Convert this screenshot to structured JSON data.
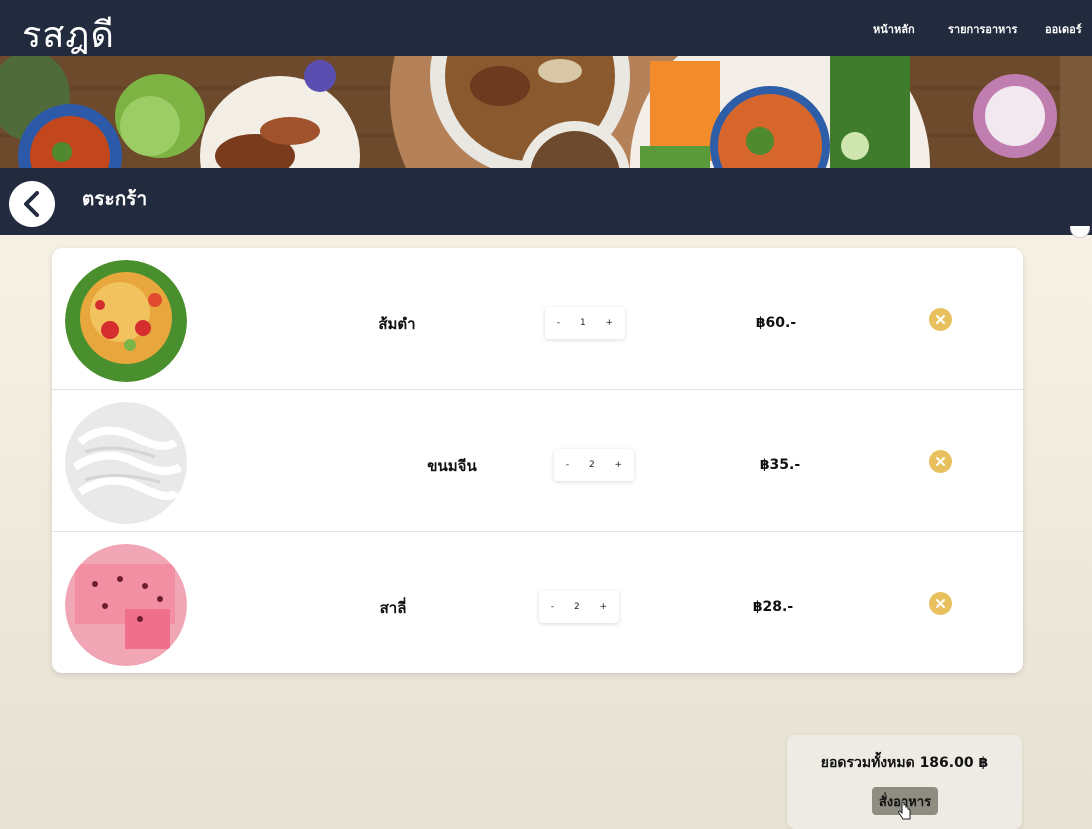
{
  "brand": {
    "name": "รสฎดี"
  },
  "nav": {
    "items": [
      {
        "label": "หน้าหลัก"
      },
      {
        "label": "รายการอาหาร"
      },
      {
        "label": "ออเดอร์"
      }
    ]
  },
  "header": {
    "title": "ตระกร้า"
  },
  "cart": {
    "items": [
      {
        "name": "ส้มตำ",
        "quantity": "1",
        "price": "฿60.-"
      },
      {
        "name": "ขนมจีน",
        "quantity": "2",
        "price": "฿35.-"
      },
      {
        "name": "สาลี่",
        "quantity": "2",
        "price": "฿28.-"
      }
    ],
    "minus_label": "-",
    "plus_label": "+"
  },
  "summary": {
    "total_text": "ยอดรวมทั้งหมด 186.00 ฿",
    "order_label": "สั่งอาหาร"
  },
  "colors": {
    "navbar": "#222a3d",
    "remove_button": "#e8c15e",
    "background": "#f4efe2"
  },
  "icons": {
    "back": "chevron-left-icon",
    "remove": "close-circle-icon",
    "cursor": "hand-pointer-icon"
  }
}
